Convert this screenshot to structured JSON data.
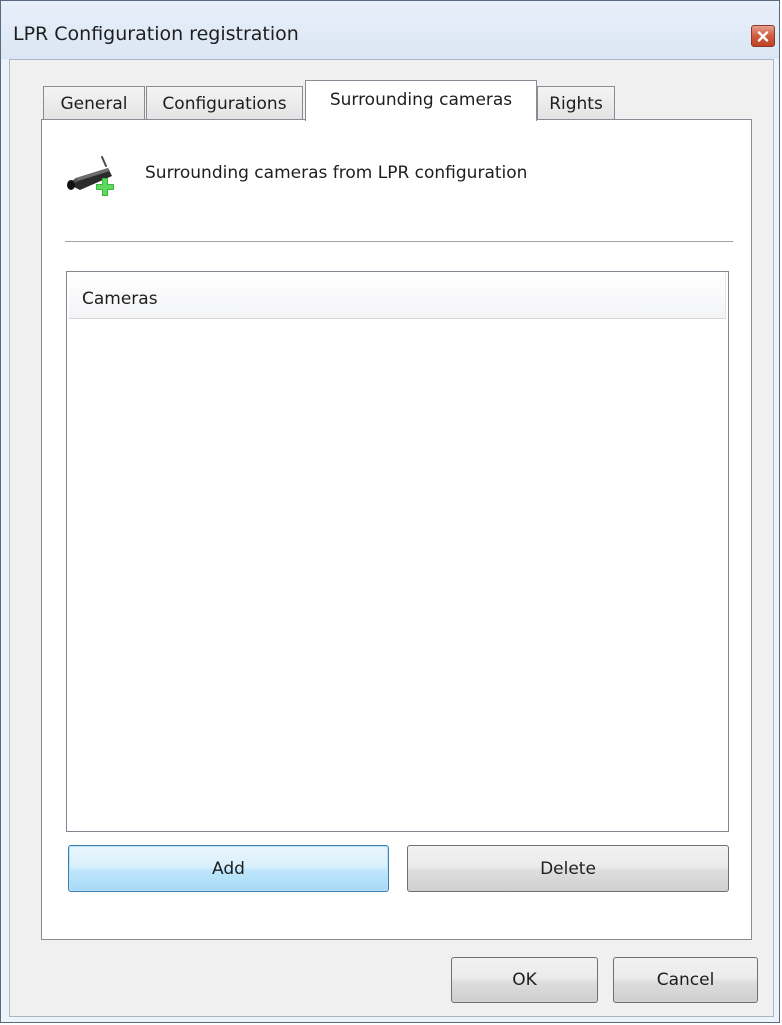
{
  "window": {
    "title": "LPR Configuration registration",
    "close_icon": "close-icon"
  },
  "tabs": [
    {
      "label": "General",
      "active": false
    },
    {
      "label": "Configurations",
      "active": false
    },
    {
      "label": "Surrounding cameras",
      "active": true
    },
    {
      "label": "Rights",
      "active": false
    }
  ],
  "panel": {
    "header_icon": "camera-add-icon",
    "header_text": "Surrounding cameras from LPR configuration",
    "list": {
      "column_header": "Cameras",
      "rows": []
    },
    "add_label": "Add",
    "delete_label": "Delete"
  },
  "footer": {
    "ok_label": "OK",
    "cancel_label": "Cancel"
  },
  "colors": {
    "titlebar": "#dbe6f4",
    "close_button": "#c24325",
    "focused_button_border": "#3c7fb1",
    "plus_green": "#3cb83c"
  }
}
